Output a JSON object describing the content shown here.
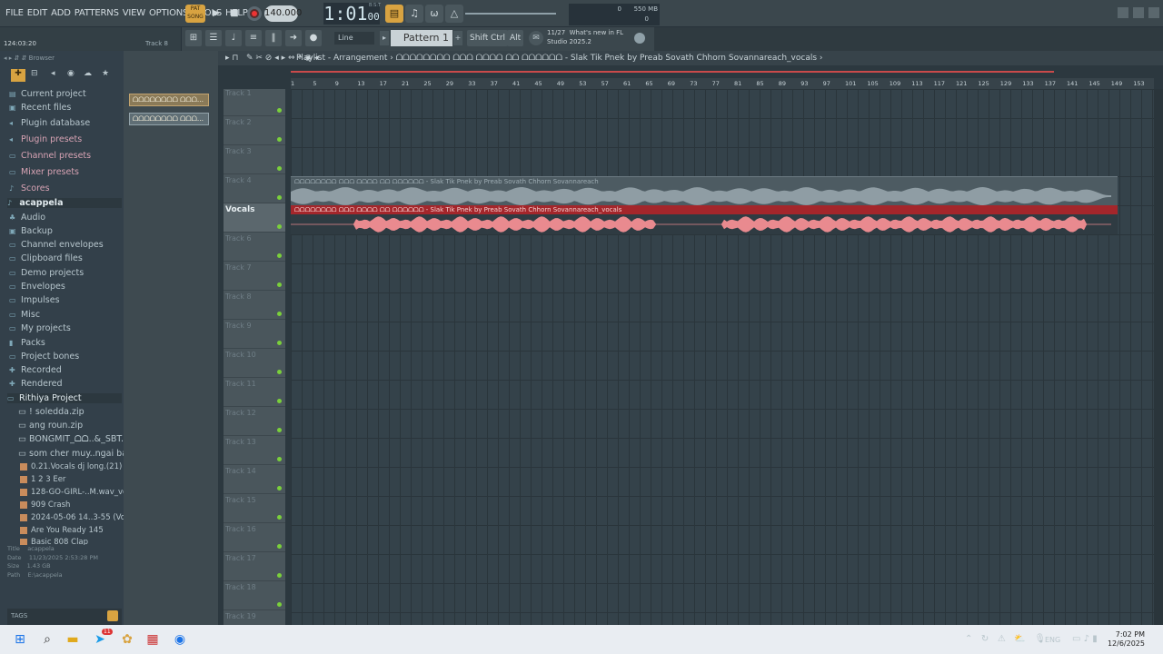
{
  "menu": [
    "FILE",
    "EDIT",
    "ADD",
    "PATTERNS",
    "VIEW",
    "OPTIONS",
    "TOOLS",
    "HELP"
  ],
  "pat_label": "PAT",
  "pat_sub": "SONG",
  "tempo": "140.000",
  "clock": "1:01",
  "clock_sub": "00",
  "clock_bst": "B:S:T",
  "memory": "550 MB",
  "meter_value": "0",
  "meter_value2": "0",
  "status": {
    "time": "124:03:20",
    "track": "Track 8"
  },
  "snap": "Line",
  "pattern": "Pattern 1",
  "keys": [
    "Shift",
    "Ctrl",
    "Alt"
  ],
  "news": {
    "date": "11/27",
    "title": "What's new in FL",
    "sub": "Studio 2025.2"
  },
  "browser": {
    "title": "Browser",
    "items": [
      {
        "label": "Current project",
        "icon": "▤"
      },
      {
        "label": "Recent files",
        "icon": "▣"
      },
      {
        "label": "Plugin database",
        "icon": "◂"
      },
      {
        "label": "Plugin presets",
        "icon": "◂"
      },
      {
        "label": "Channel presets",
        "icon": "▭"
      },
      {
        "label": "Mixer presets",
        "icon": "▭"
      },
      {
        "label": "Scores",
        "icon": "♪"
      },
      {
        "label": "acappela",
        "icon": "♪"
      },
      {
        "label": "Audio",
        "icon": "♣"
      },
      {
        "label": "Backup",
        "icon": "▣"
      },
      {
        "label": "Channel envelopes",
        "icon": "▭"
      },
      {
        "label": "Clipboard files",
        "icon": "▭"
      },
      {
        "label": "Demo projects",
        "icon": "▭"
      },
      {
        "label": "Envelopes",
        "icon": "▭"
      },
      {
        "label": "Impulses",
        "icon": "▭"
      },
      {
        "label": "Misc",
        "icon": "▭"
      },
      {
        "label": "My projects",
        "icon": "▭"
      },
      {
        "label": "Packs",
        "icon": "▮"
      },
      {
        "label": "Project bones",
        "icon": "▭"
      },
      {
        "label": "Recorded",
        "icon": "✚"
      },
      {
        "label": "Rendered",
        "icon": "✚"
      },
      {
        "label": "Rithiya Project",
        "icon": "▭"
      }
    ],
    "subitems": [
      "! soledda.zip",
      "ang roun.zip",
      "BONGMIT_ᗝᗝ..&_SBT.zip",
      "som cher muy..ngai ban hz"
    ],
    "files": [
      "0.21.Vocals dj long.(21)",
      "1 2 3 Eer",
      "128-GO-GIRL-..M.wav_vocals",
      "909 Crash",
      "2024-05-06 14..3-55 (Vocals)",
      "Are You Ready 145",
      "Basic 808 Clap"
    ],
    "info": {
      "title_k": "Title",
      "title_v": "acappela",
      "date_k": "Date",
      "date_v": "11/23/2025 2:53:28 PM",
      "size_k": "Size",
      "size_v": "1.43 GB",
      "path_k": "Path",
      "path_v": "E:\\acappela"
    },
    "tags": "TAGS"
  },
  "channels": [
    "ᗝᗝᗝᗝᗝᗝᗝᗝ ᗝᗝᗝ...",
    "ᗝᗝᗝᗝᗝᗝᗝᗝ ᗝᗝᗝ..."
  ],
  "playlist": {
    "title": "Playlist - Arrangement",
    "crumb": "ᗝᗝᗝᗝᗝᗝᗝᗝ ᗝᗝᗝ ᗝᗝᗝᗝ  ᗝᗝ ᗝᗝᗝᗝᗝᗝ - Slak Tik Pnek by Preab Sovath  Chhorn Sovannareach_vocals",
    "ruler": [
      "1",
      "5",
      "9",
      "13",
      "17",
      "21",
      "25",
      "29",
      "33",
      "37",
      "41",
      "45",
      "49",
      "53",
      "57",
      "61",
      "65",
      "69",
      "73",
      "77",
      "81",
      "85",
      "89",
      "93",
      "97",
      "101",
      "105",
      "109",
      "113",
      "117",
      "121",
      "125",
      "129",
      "133",
      "137",
      "141",
      "145",
      "149",
      "153"
    ],
    "tracks": [
      "Track 1",
      "Track 2",
      "Track 3",
      "Track 4",
      "Vocals",
      "Track 6",
      "Track 7",
      "Track 8",
      "Track 9",
      "Track 10",
      "Track 11",
      "Track 12",
      "Track 13",
      "Track 14",
      "Track 15",
      "Track 16",
      "Track 17",
      "Track 18",
      "Track 19"
    ],
    "clip1": "ᗝᗝᗝᗝᗝᗝᗝᗝ ᗝᗝᗝ ᗝᗝᗝᗝ  ᗝᗝ ᗝᗝᗝᗝᗝᗝ - Slak Tik Pnek by Preab Sovath  Chhorn Sovannareach",
    "clip2": "ᗝᗝᗝᗝᗝᗝᗝᗝ ᗝᗝᗝ ᗝᗝᗝᗝ  ᗝᗝ ᗝᗝᗝᗝᗝᗝ - Slak Tik Pnek by Preab Sovath  Chhorn Sovannareach_vocals"
  },
  "taskbar": {
    "lang": "ENG",
    "time": "7:02 PM",
    "date": "12/6/2025",
    "badge": "11"
  }
}
